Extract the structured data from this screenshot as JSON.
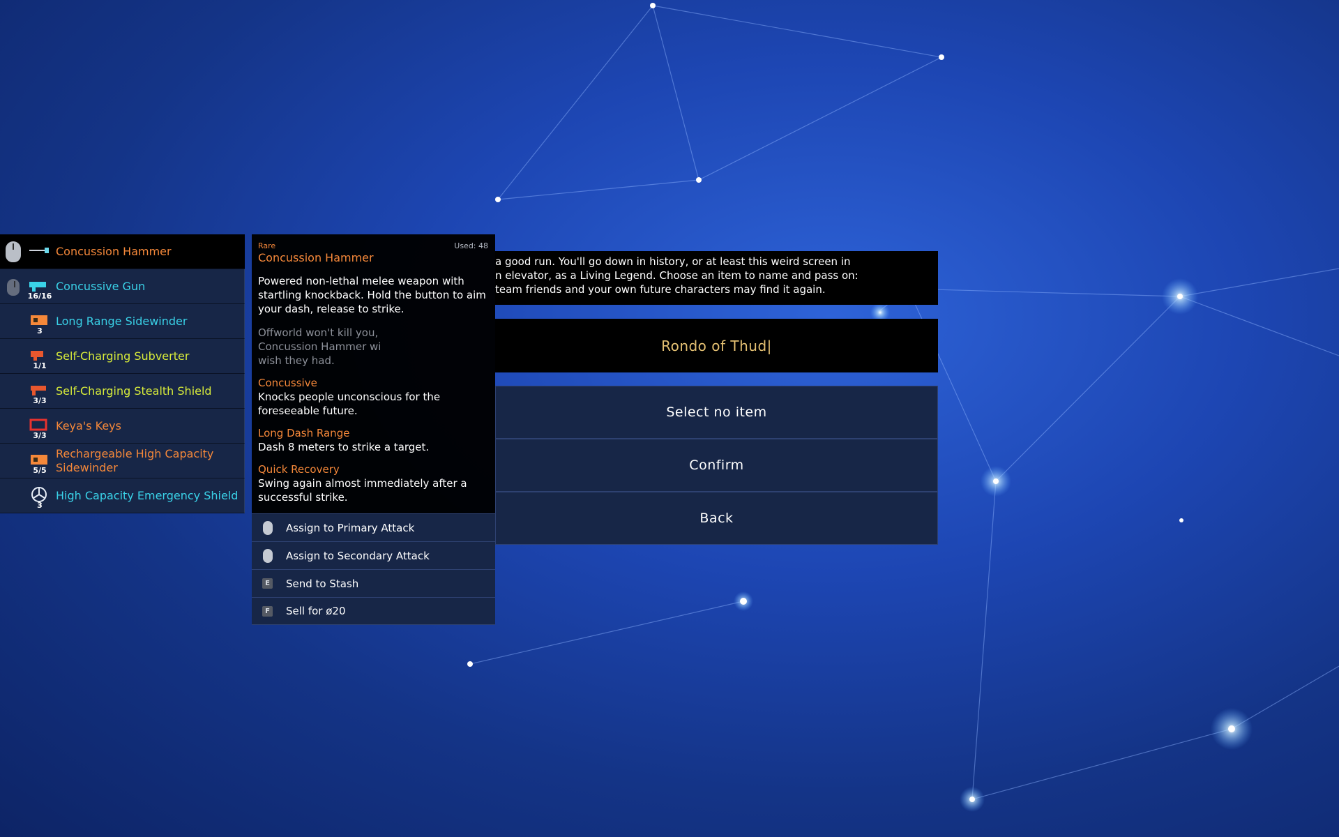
{
  "inventory": [
    {
      "name": "Concussion Hammer",
      "color": "#f5883a",
      "count": "",
      "slot": "primary",
      "selected": true
    },
    {
      "name": "Concussive Gun",
      "color": "#3ad2e8",
      "count": "16/16",
      "slot": "secondary",
      "selected": false
    },
    {
      "name": "Long Range Sidewinder",
      "color": "#3ad2e8",
      "count": "3",
      "slot": "",
      "selected": false
    },
    {
      "name": "Self-Charging Subverter",
      "color": "#d8ec3a",
      "count": "1/1",
      "slot": "",
      "selected": false
    },
    {
      "name": "Self-Charging Stealth Shield",
      "color": "#d8ec3a",
      "count": "3/3",
      "slot": "",
      "selected": false
    },
    {
      "name": "Keya's Keys",
      "color": "#f5883a",
      "count": "3/3",
      "slot": "",
      "selected": false
    },
    {
      "name": "Rechargeable High Capacity Sidewinder",
      "color": "#f5883a",
      "count": "5/5",
      "slot": "",
      "selected": false
    },
    {
      "name": "High Capacity Emergency Shield",
      "color": "#3ad2e8",
      "count": "3",
      "slot": "",
      "selected": false
    }
  ],
  "tooltip": {
    "rarity": "Rare",
    "used": "Used: 48",
    "title": "Concussion Hammer",
    "description": "Powered non-lethal melee weapon with startling knockback. Hold the button to aim your dash, release to strike.",
    "flavor": "Offworld won't kill you, Concussion Hammer wi wish they had.",
    "perks": [
      {
        "name": "Concussive",
        "desc": "Knocks people unconscious for the foreseeable future."
      },
      {
        "name": "Long Dash Range",
        "desc": "Dash 8 meters to strike a target."
      },
      {
        "name": "Quick Recovery",
        "desc": "Swing again almost immediately after a successful strike."
      }
    ]
  },
  "actions": [
    {
      "key": "",
      "input": "mouse-left",
      "label": "Assign to Primary Attack"
    },
    {
      "key": "",
      "input": "mouse-right",
      "label": "Assign to Secondary Attack"
    },
    {
      "key": "E",
      "input": "key",
      "label": "Send to Stash"
    },
    {
      "key": "F",
      "input": "key",
      "label": "Sell for ø20"
    }
  ],
  "legend": {
    "lines": [
      "a good run. You'll go down in history, or at least this weird screen in",
      "n elevator, as a Living Legend. Choose an item to name and pass on:",
      "team friends and your own future characters may find it again."
    ],
    "name_value": "Rondo of Thud|"
  },
  "buttons": {
    "select_none": "Select no item",
    "confirm": "Confirm",
    "back": "Back"
  }
}
